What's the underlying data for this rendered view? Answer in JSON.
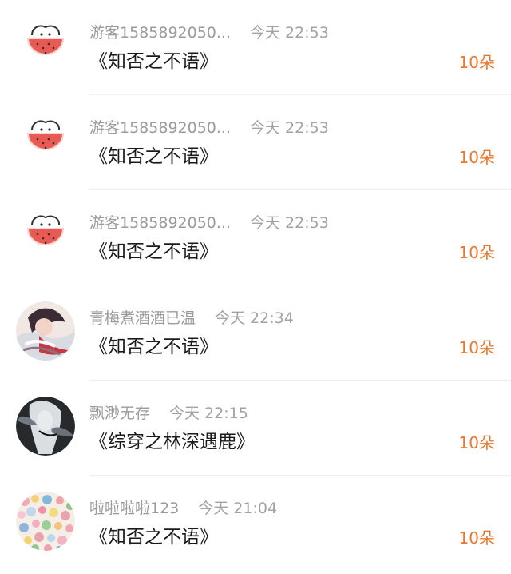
{
  "messages": [
    {
      "username": "游客1585892050...",
      "time": "今天 22:53",
      "book": "《知否之不语》",
      "gift": "10朵",
      "avatar": "watermelon-avatar"
    },
    {
      "username": "游客1585892050...",
      "time": "今天 22:53",
      "book": "《知否之不语》",
      "gift": "10朵",
      "avatar": "watermelon-avatar"
    },
    {
      "username": "游客1585892050...",
      "time": "今天 22:53",
      "book": "《知否之不语》",
      "gift": "10朵",
      "avatar": "watermelon-avatar"
    },
    {
      "username": "青梅煮酒酒已温",
      "time": "今天 22:34",
      "book": "《知否之不语》",
      "gift": "10朵",
      "avatar": "illustrated-character-avatar"
    },
    {
      "username": "飘渺无存",
      "time": "今天 22:15",
      "book": "《综穿之林深遇鹿》",
      "gift": "10朵",
      "avatar": "dark-character-avatar"
    },
    {
      "username": "啦啦啦啦123",
      "time": "今天 21:04",
      "book": "《知否之不语》",
      "gift": "10朵",
      "avatar": "floral-pattern-avatar"
    }
  ],
  "colors": {
    "gift": "#e8782f",
    "meta": "#9b9b9b",
    "title": "#1a1a1a"
  }
}
